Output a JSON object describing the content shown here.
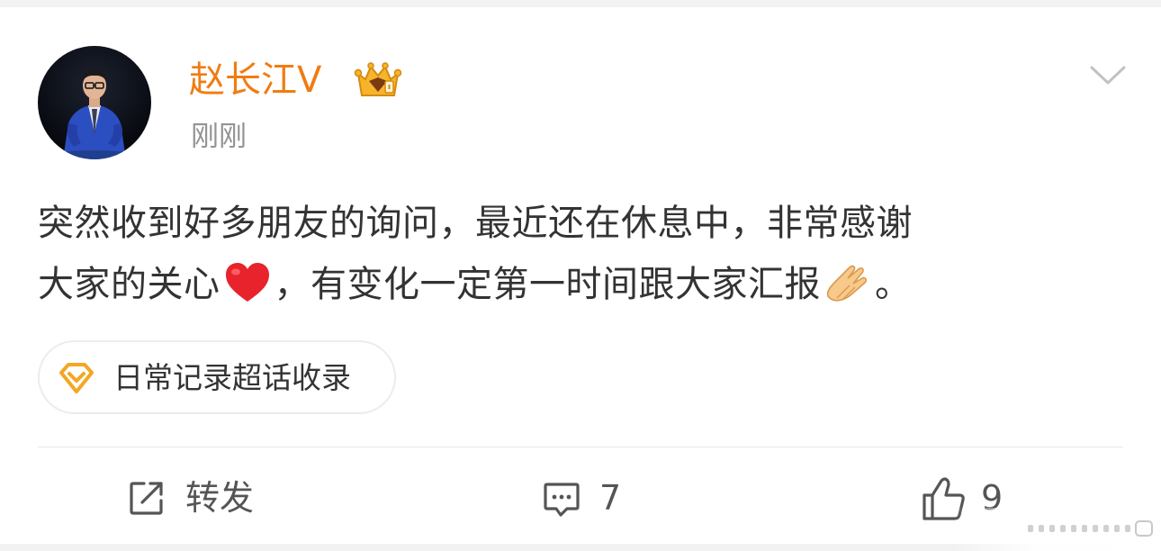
{
  "post": {
    "author": {
      "name": "赵长江",
      "verified_mark": "V",
      "badge_icon": "crown-vip-icon"
    },
    "time": "刚刚",
    "content": {
      "line1": "突然收到好多朋友的询问，最近还在休息中，非常感谢",
      "line2_part1": "大家的关心",
      "line2_emoji1": "red-heart-icon",
      "line2_part2": "，有变化一定第一时间跟大家汇报",
      "line2_emoji2": "clap-hands-icon",
      "line2_part3": "。"
    },
    "topic": {
      "icon": "super-topic-diamond-icon",
      "label": "日常记录超话收录"
    }
  },
  "actions": {
    "repost": {
      "icon": "repost-icon",
      "label": "转发"
    },
    "comment": {
      "icon": "comment-icon",
      "count": "7"
    },
    "like": {
      "icon": "thumb-up-icon",
      "count": "9"
    }
  },
  "colors": {
    "author_name": "#f07c12",
    "time": "#939393",
    "text": "#333333",
    "topic_icon": "#f5a623",
    "icon_gray": "#555555",
    "page_bg": "#f2f2f2"
  }
}
